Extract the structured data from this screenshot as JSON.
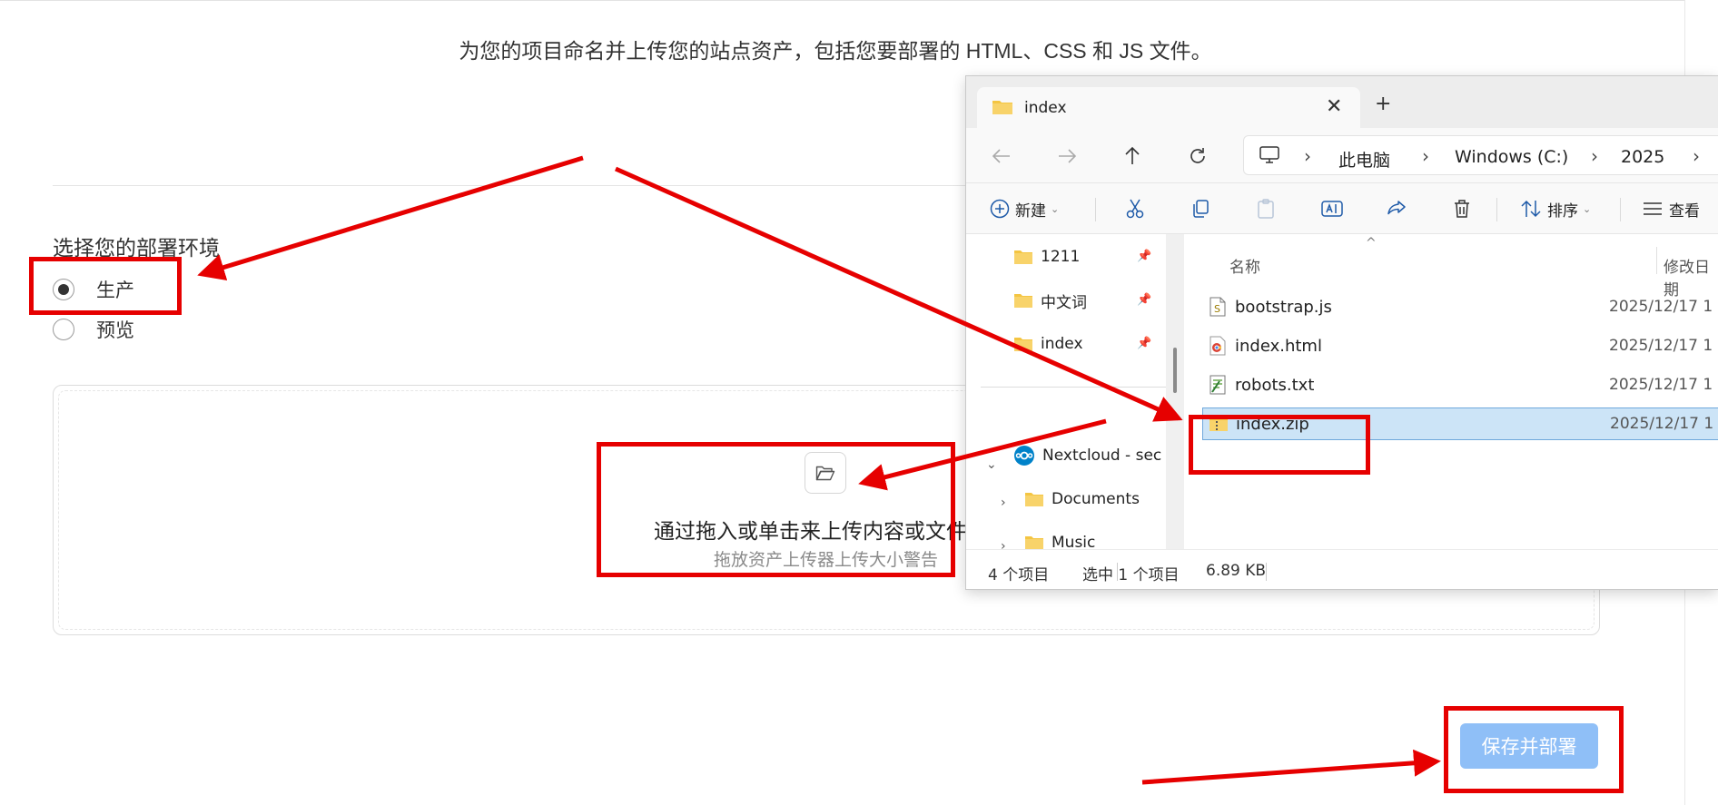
{
  "page": {
    "intro": "为您的项目命名并上传您的站点资产，包括您要部署的 HTML、CSS 和 JS 文件。",
    "env_title": "选择您的部署环境",
    "env_options": [
      {
        "label": "生产",
        "selected": true
      },
      {
        "label": "预览",
        "selected": false
      }
    ],
    "dropzone_title": "通过拖入或单击来上传内容或文件夹",
    "dropzone_subtitle": "拖放资产上传器上传大小警告",
    "save_label": "保存并部署"
  },
  "explorer": {
    "tab_title": "index",
    "breadcrumb": [
      "此电脑",
      "Windows (C:)",
      "2025"
    ],
    "toolbar": {
      "new": "新建",
      "sort": "排序",
      "view": "查看"
    },
    "nav": {
      "quick": [
        {
          "label": "1211",
          "pinned": true
        },
        {
          "label": "中文词",
          "pinned": true
        },
        {
          "label": "index",
          "pinned": true
        }
      ],
      "cloud": "Nextcloud - sec",
      "children": [
        {
          "label": "Documents"
        },
        {
          "label": "Music"
        }
      ]
    },
    "columns": {
      "name": "名称",
      "date": "修改日期"
    },
    "files": [
      {
        "name": "bootstrap.js",
        "date": "2025/12/17 1",
        "icon": "js-file-icon",
        "selected": false
      },
      {
        "name": "index.html",
        "date": "2025/12/17 1",
        "icon": "html-file-icon",
        "selected": false
      },
      {
        "name": "robots.txt",
        "date": "2025/12/17 1",
        "icon": "text-file-icon",
        "selected": false
      },
      {
        "name": "index.zip",
        "date": "2025/12/17 1",
        "icon": "zip-file-icon",
        "selected": true
      }
    ],
    "status": {
      "count": "4 个项目",
      "selection": "选中 1 个项目",
      "size": "6.89 KB"
    }
  },
  "colors": {
    "annotation": "#e60000",
    "save_button": "#8fbff7",
    "selection": "#cce4f7",
    "folder": "#f4c542"
  }
}
